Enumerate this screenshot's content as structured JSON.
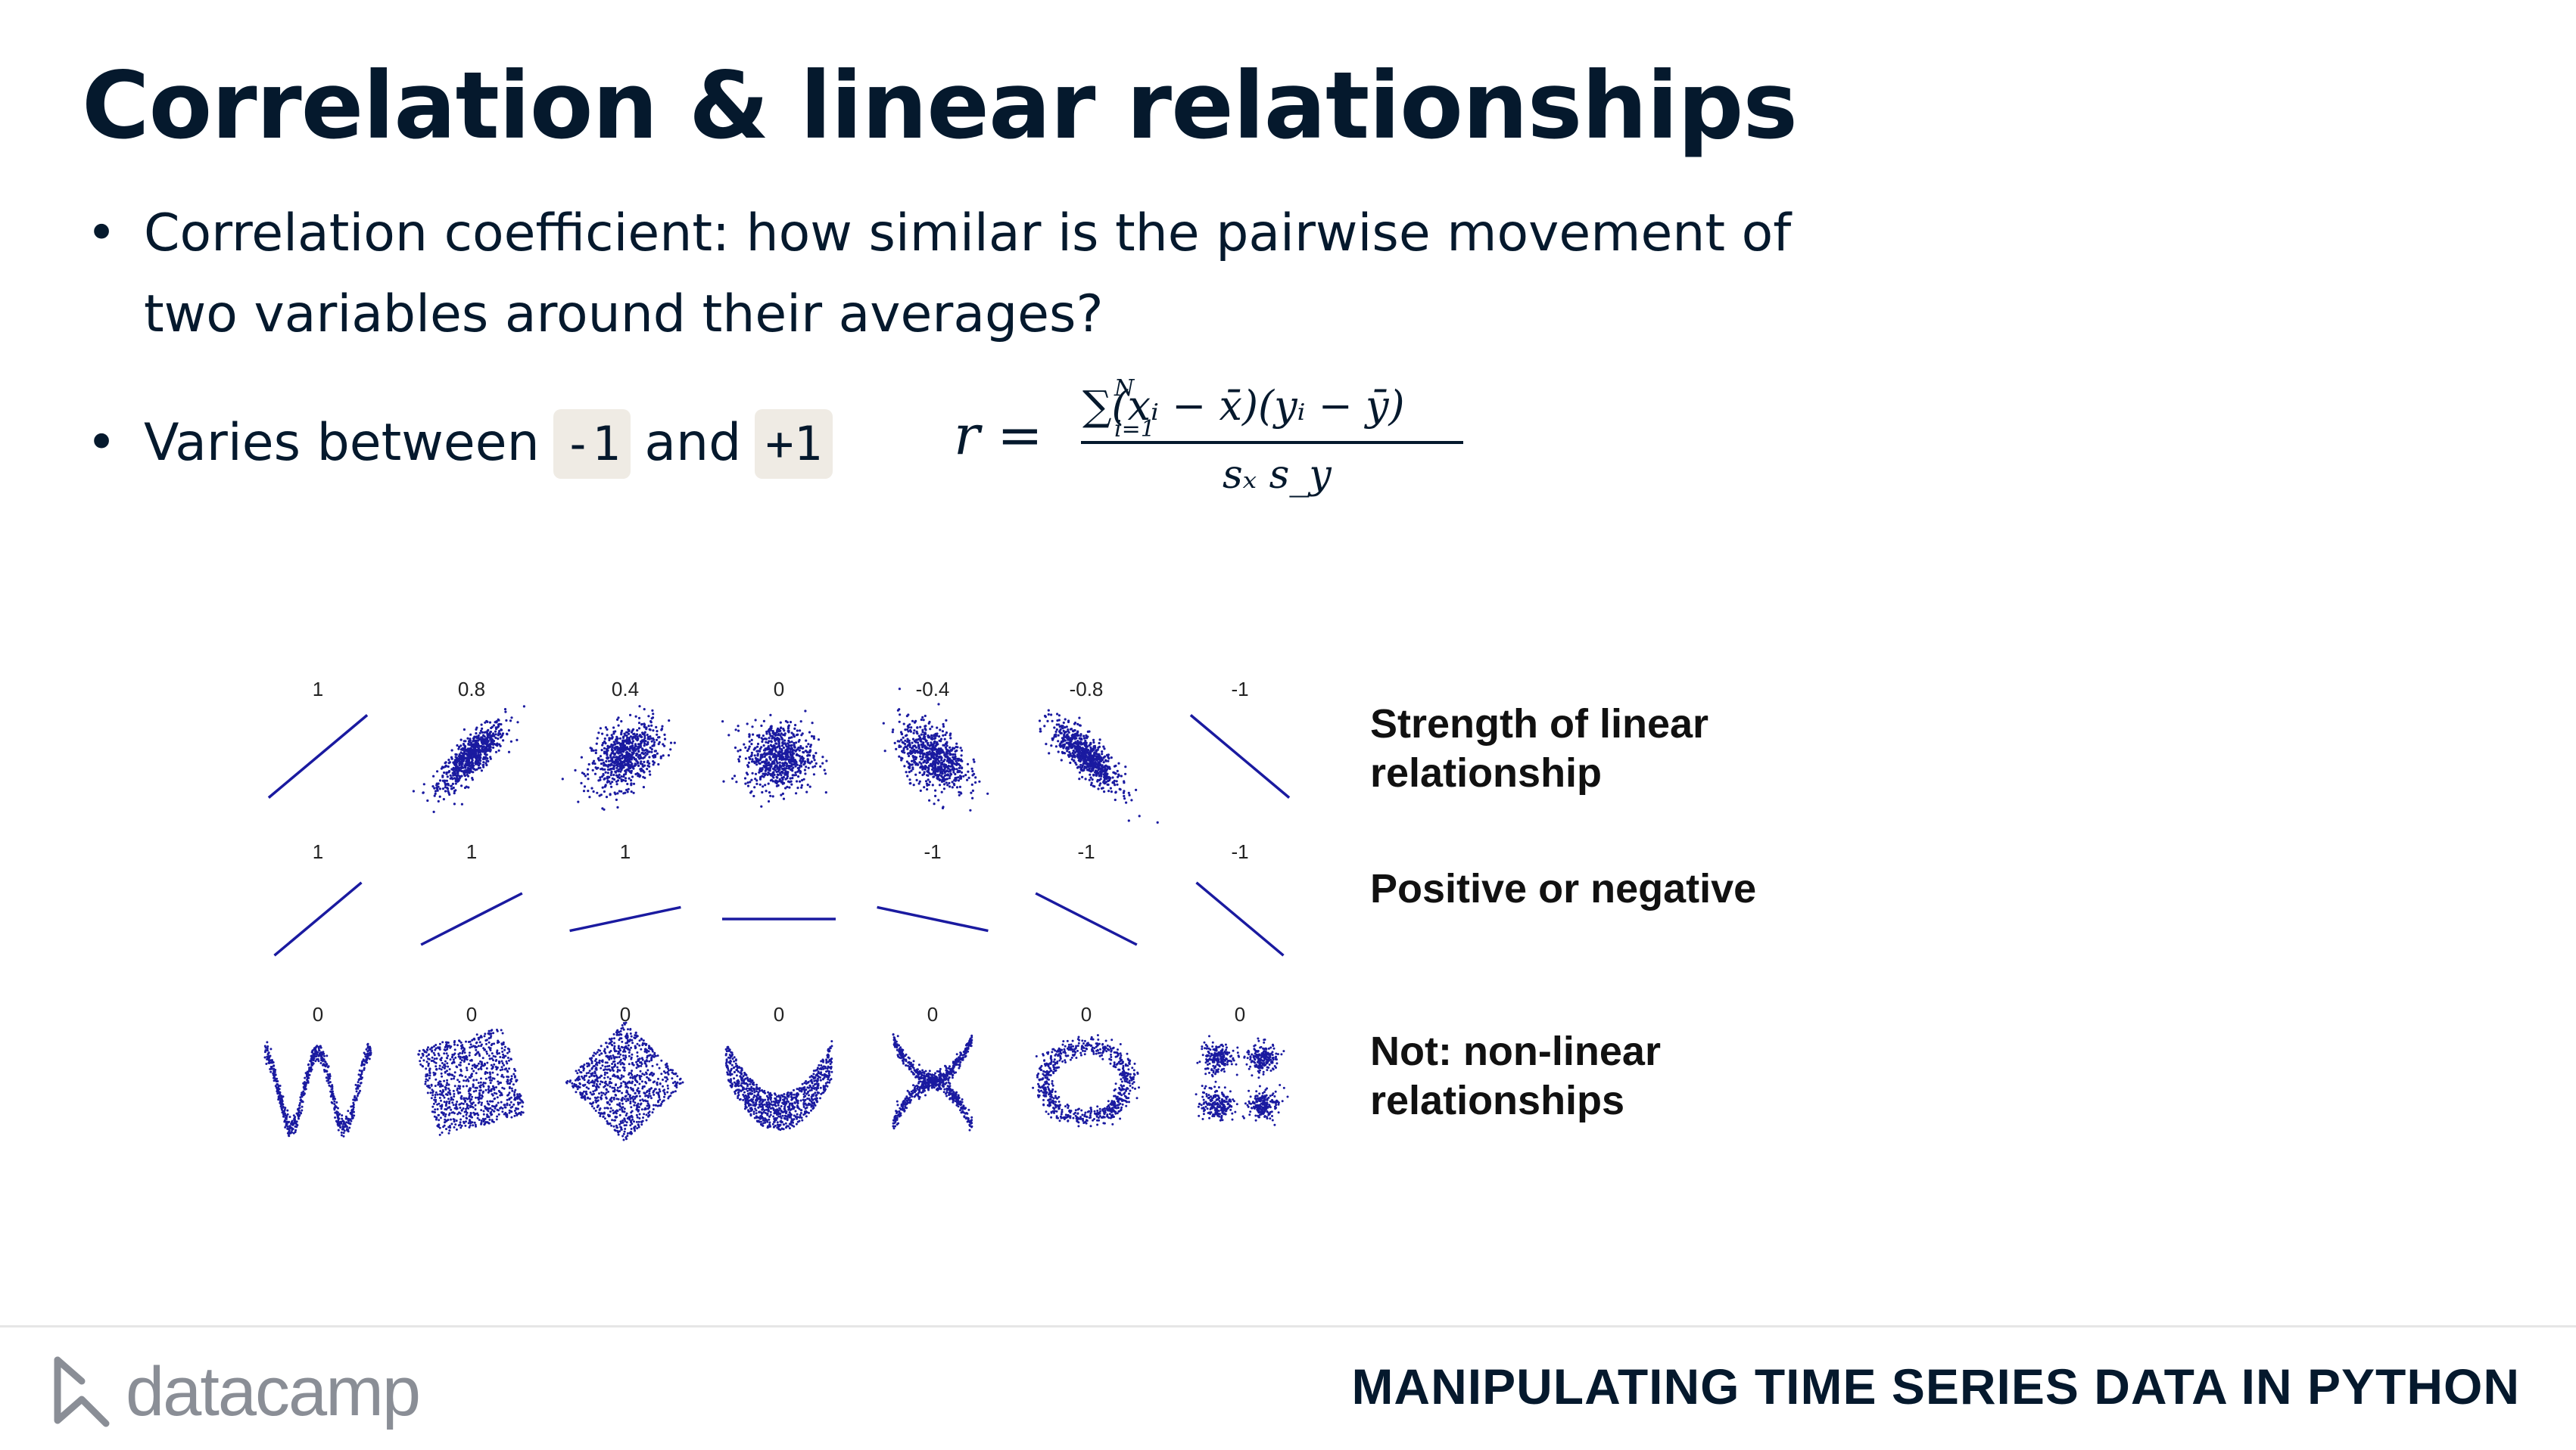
{
  "slide": {
    "title": "Correlation & linear relationships",
    "bullet1": "Correlation coefficient: how similar is the pairwise movement of two variables around their averages?",
    "bullet2": {
      "before": "Varies between",
      "code_low": "-1",
      "middle": "and",
      "code_high": "+1"
    },
    "formula": {
      "lhs": "r =",
      "numerator": "∑(xᵢ − x̄)(yᵢ − ȳ)",
      "sum_sub": "i=1",
      "sum_sup": "N",
      "denominator": "sₓ s_y"
    }
  },
  "figure": {
    "rows": [
      {
        "labels": [
          "1",
          "0.8",
          "0.4",
          "0",
          "-0.4",
          "-0.8",
          "-1"
        ],
        "description": "Strength of linear relationship"
      },
      {
        "labels": [
          "1",
          "1",
          "1",
          "",
          "-1",
          "-1",
          "-1"
        ],
        "description": "Positive or negative"
      },
      {
        "labels": [
          "0",
          "0",
          "0",
          "0",
          "0",
          "0",
          "0"
        ],
        "description": "Not: non-linear relationships"
      }
    ],
    "point_color": "#1a1aa0"
  },
  "footer": {
    "brand": "datacamp",
    "course": "MANIPULATING TIME SERIES DATA IN PYTHON"
  }
}
